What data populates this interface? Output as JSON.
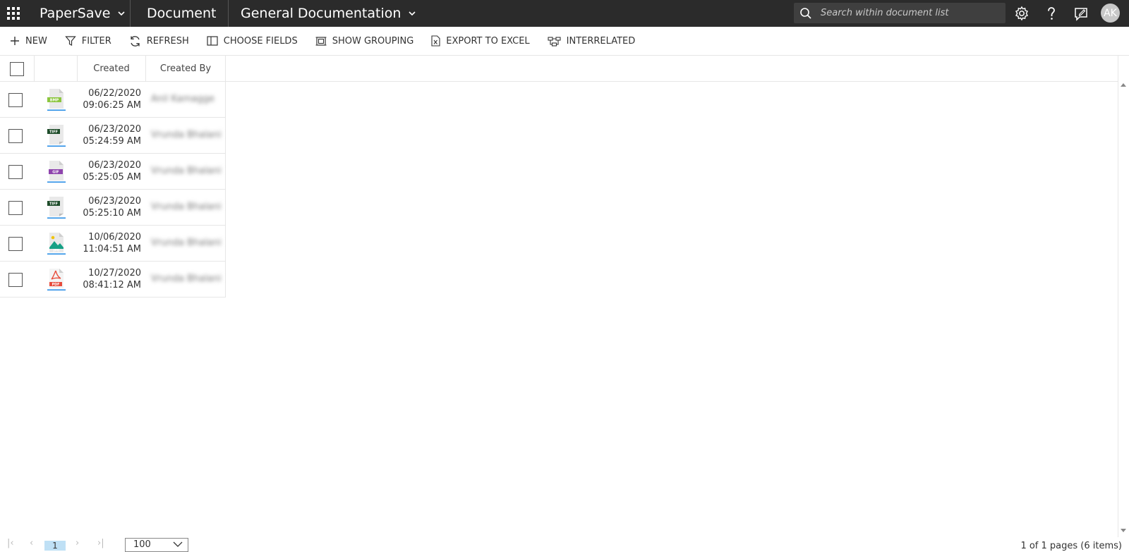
{
  "topbar": {
    "app_name": "PaperSave",
    "section": "Document",
    "category": "General Documentation",
    "search_placeholder": "Search within document list",
    "avatar_initials": "AK"
  },
  "toolbar": {
    "new": "NEW",
    "filter": "FILTER",
    "refresh": "REFRESH",
    "choose_fields": "CHOOSE FIELDS",
    "show_grouping": "SHOW GROUPING",
    "export_excel": "EXPORT TO EXCEL",
    "interrelated": "INTERRELATED"
  },
  "grid": {
    "columns": {
      "created": "Created",
      "created_by": "Created By"
    },
    "rows": [
      {
        "type": "BMP",
        "date": "06/22/2020",
        "time": "09:06:25 AM",
        "created_by": "Anil Kamagge"
      },
      {
        "type": "TIFF",
        "date": "06/23/2020",
        "time": "05:24:59 AM",
        "created_by": "Vrunda Bhalani"
      },
      {
        "type": "GIF",
        "date": "06/23/2020",
        "time": "05:25:05 AM",
        "created_by": "Vrunda Bhalani"
      },
      {
        "type": "TIFF",
        "date": "06/23/2020",
        "time": "05:25:10 AM",
        "created_by": "Vrunda Bhalani"
      },
      {
        "type": "JPG",
        "date": "10/06/2020",
        "time": "11:04:51 AM",
        "created_by": "Vrunda Bhalani"
      },
      {
        "type": "PDF",
        "date": "10/27/2020",
        "time": "08:41:12 AM",
        "created_by": "Vrunda Bhalani"
      }
    ]
  },
  "pager": {
    "current_page": "1",
    "page_size": "100",
    "info": "1 of 1 pages (6 items)"
  },
  "colors": {
    "topbar_bg": "#2b2b2b",
    "search_bg": "#3f3f3f",
    "pager_active": "#bfe0f5",
    "bmp": "#8cc63f",
    "tiff": "#1f4d2b",
    "gif": "#8e44ad",
    "jpg": "#16a085",
    "pdf": "#e74c3c"
  }
}
